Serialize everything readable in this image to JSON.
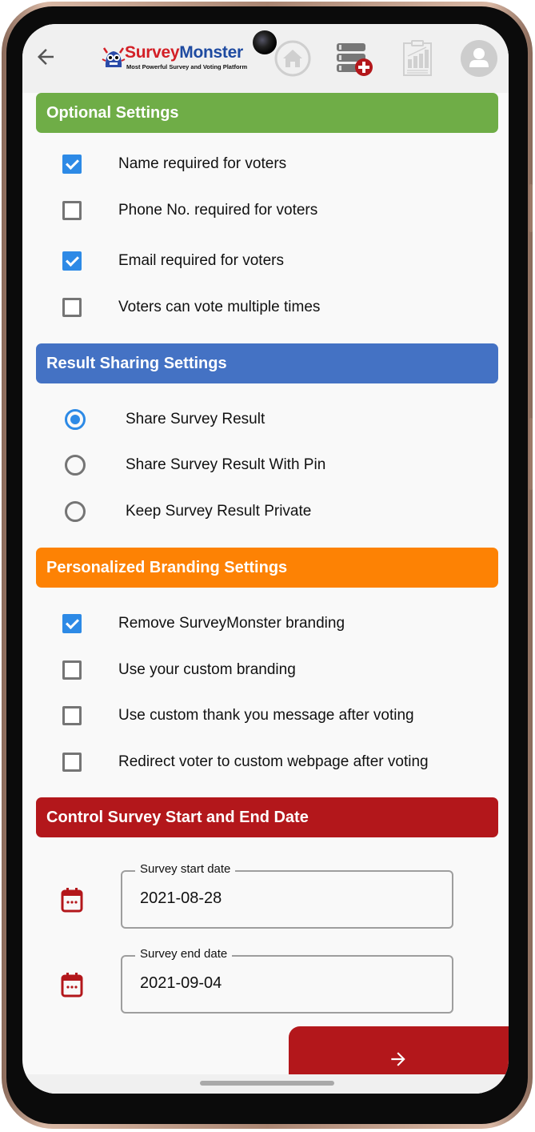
{
  "appbar": {
    "back_icon": "arrow-left-icon",
    "logo": {
      "title_part1": "Survey",
      "title_part2": "Monster",
      "tagline": "Most Powerful Survey and Voting Platform"
    },
    "nav_icons": [
      "home-icon",
      "database-add-icon",
      "report-chart-icon",
      "user-avatar-icon"
    ]
  },
  "colors": {
    "optional": "#6fad47",
    "result": "#4472c4",
    "branding": "#fd8204",
    "date": "#b3171b",
    "checkbox_on": "#2d8ae6"
  },
  "optional_settings": {
    "title": "Optional Settings",
    "items": [
      {
        "label": "Name required for voters",
        "checked": true
      },
      {
        "label": "Phone No. required for voters",
        "checked": false
      },
      {
        "label": "Email required for voters",
        "checked": true
      },
      {
        "label": "Voters can vote multiple times",
        "checked": false
      }
    ]
  },
  "result_sharing": {
    "title": "Result Sharing Settings",
    "options": [
      {
        "label": "Share Survey Result",
        "selected": true
      },
      {
        "label": "Share Survey Result With Pin",
        "selected": false
      },
      {
        "label": "Keep Survey Result Private",
        "selected": false
      }
    ]
  },
  "branding": {
    "title": "Personalized Branding Settings",
    "items": [
      {
        "label": "Remove SurveyMonster branding",
        "checked": true
      },
      {
        "label": "Use your custom branding",
        "checked": false
      },
      {
        "label": "Use custom thank you message after voting",
        "checked": false
      },
      {
        "label": "Redirect voter to custom webpage after voting",
        "checked": false
      }
    ]
  },
  "dates": {
    "title": "Control Survey Start and End Date",
    "start": {
      "label": "Survey start date",
      "value": "2021-08-28"
    },
    "end": {
      "label": "Survey end date",
      "value": "2021-09-04"
    }
  },
  "footer": {
    "next_icon": "arrow-right-icon"
  }
}
